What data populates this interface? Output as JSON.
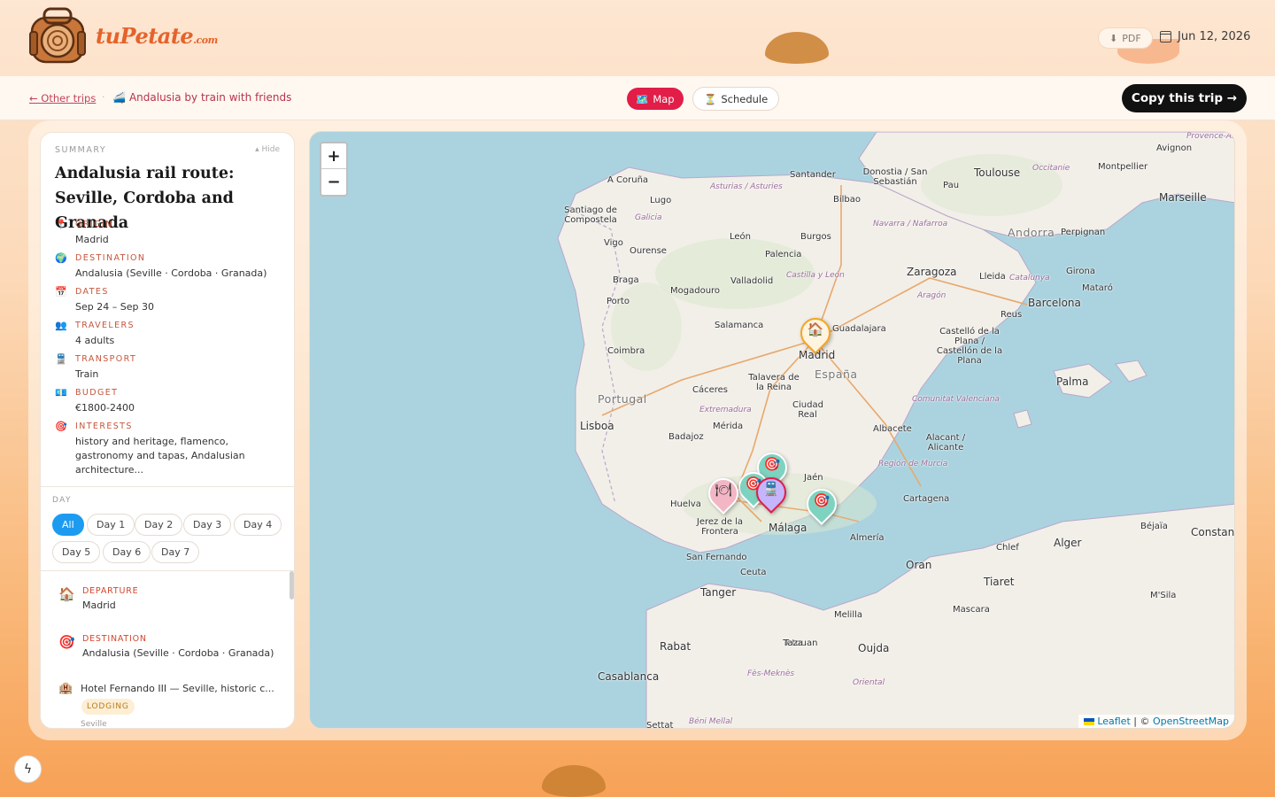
{
  "brand": {
    "name": "tuPetate",
    "suffix": ".com"
  },
  "header": {
    "pdf_label": "PDF",
    "date": "Jun 12, 2026"
  },
  "nav": {
    "back_label": "← Other trips",
    "trip_icon": "🚄",
    "trip_title": "Andalusia by train with friends",
    "tab_map": "Map",
    "tab_map_icon": "🗺️",
    "tab_schedule": "Schedule",
    "tab_schedule_icon": "⏳",
    "copy_label": "Copy this trip →"
  },
  "summary": {
    "label": "SUMMARY",
    "hide_label": "▴ Hide",
    "title": "Andalusia rail route: Seville, Cordoba and Granada",
    "fields": [
      {
        "icon": "📍",
        "label": "ORIGIN",
        "value": "Madrid"
      },
      {
        "icon": "🌍",
        "label": "DESTINATION",
        "value": "Andalusia (Seville · Cordoba · Granada)"
      },
      {
        "icon": "📅",
        "label": "DATES",
        "value": "Sep 24 – Sep 30"
      },
      {
        "icon": "👥",
        "label": "TRAVELERS",
        "value": "4 adults"
      },
      {
        "icon": "🚆",
        "label": "TRANSPORT",
        "value": "Train"
      },
      {
        "icon": "💶",
        "label": "BUDGET",
        "value": "€1800-2400"
      },
      {
        "icon": "🎯",
        "label": "INTERESTS",
        "value": "history and heritage, flamenco, gastronomy and tapas, Andalusian architecture..."
      }
    ]
  },
  "days": {
    "label": "DAY",
    "chips": [
      "All",
      "Day 1",
      "Day 2",
      "Day 3",
      "Day 4",
      "Day 5",
      "Day 6",
      "Day 7"
    ],
    "active": "All"
  },
  "events": [
    {
      "icon": "🏠",
      "label": "DEPARTURE",
      "value": "Madrid"
    },
    {
      "icon": "🎯",
      "label": "DESTINATION",
      "value": "Andalusia (Seville · Cordoba · Granada)"
    },
    {
      "icon": "🏨",
      "value": "Hotel Fernando III — Seville, historic c...",
      "badge": "LODGING",
      "sub": "Seville"
    }
  ],
  "map": {
    "zoom_in": "+",
    "zoom_out": "−",
    "attribution_leaflet": "Leaflet",
    "attribution_sep": " | © ",
    "attribution_osm": "OpenStreetMap",
    "countries": [
      "Portugal",
      "España",
      "Andorra"
    ],
    "cities": [
      "A Coruña",
      "Lugo",
      "Santiago de Compostela",
      "Vigo",
      "Ourense",
      "Braga",
      "Porto",
      "Coimbra",
      "Lisboa",
      "Santander",
      "Donostia / San Sebastián",
      "Bilbao",
      "León",
      "Burgos",
      "Palencia",
      "Valladolid",
      "Salamanca",
      "Mogadouro",
      "Madrid",
      "Guadalajara",
      "Talavera de la Reina",
      "Cáceres",
      "Mérida",
      "Badajoz",
      "Ciudad Real",
      "Albacete",
      "Zaragoza",
      "Lleida",
      "Reus",
      "Barcelona",
      "Girona",
      "Mataró",
      "Perpignan",
      "Toulouse",
      "Pau",
      "Montpellier",
      "Avignon",
      "Marseille",
      "Castelló de la Plana / Castellón de la Plana",
      "Palma",
      "Alacant / Alicante",
      "Cartagena",
      "Jaén",
      "Huelva",
      "Jerez de la Frontera",
      "Málaga",
      "Almería",
      "San Fernando",
      "Ceuta",
      "Tanger",
      "Tetouan",
      "Melilla",
      "Oran",
      "Alger",
      "Béjaïa",
      "Constantine",
      "Chlef",
      "Tiaret",
      "Mascara",
      "M'Sila",
      "Rabat",
      "Casablanca",
      "Taza",
      "Oujda",
      "Fès-Meknès",
      "Oriental",
      "Settat",
      "Béni Mellal"
    ],
    "regions": [
      "Asturias / Asturies",
      "Galicia",
      "Navarra / Nafarroa",
      "Castilla y León",
      "Aragón",
      "Catalunya",
      "Extremadura",
      "Comunitat Valenciana",
      "Región de Murcia",
      "Occitanie",
      "Provence-Alpes-Côte d'Azur"
    ]
  },
  "colors": {
    "accent": "#e11d48",
    "chip_active": "#1d9bf0",
    "label_orange": "#c7553a",
    "marker_home": "#f5a623",
    "marker_dest": "#7dd3c0",
    "marker_food": "#f2b6c4",
    "marker_train": "#c4b5fd"
  }
}
